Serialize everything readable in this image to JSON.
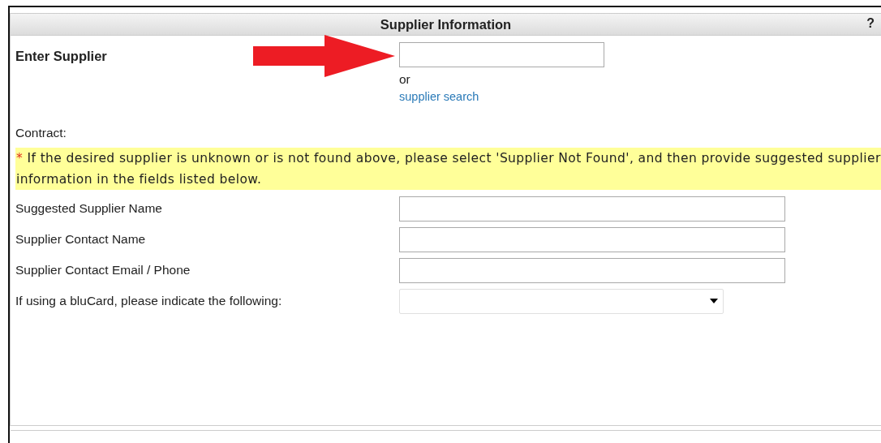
{
  "panel": {
    "title": "Supplier Information",
    "help": "?"
  },
  "supplier": {
    "label": "Enter Supplier",
    "or": "or",
    "link": "supplier search"
  },
  "contract": {
    "label": "Contract:"
  },
  "note": {
    "marker": "*",
    "text": "If the desired supplier is unknown or is not found above, please select 'Supplier Not Found', and then provide suggested supplier information in the fields listed below."
  },
  "fields": [
    {
      "label": "Suggested Supplier Name",
      "kind": "text"
    },
    {
      "label": "Supplier Contact Name",
      "kind": "text"
    },
    {
      "label": "Supplier Contact Email / Phone",
      "kind": "text"
    },
    {
      "label": "If using a bluCard, please indicate the following:",
      "kind": "select"
    }
  ]
}
